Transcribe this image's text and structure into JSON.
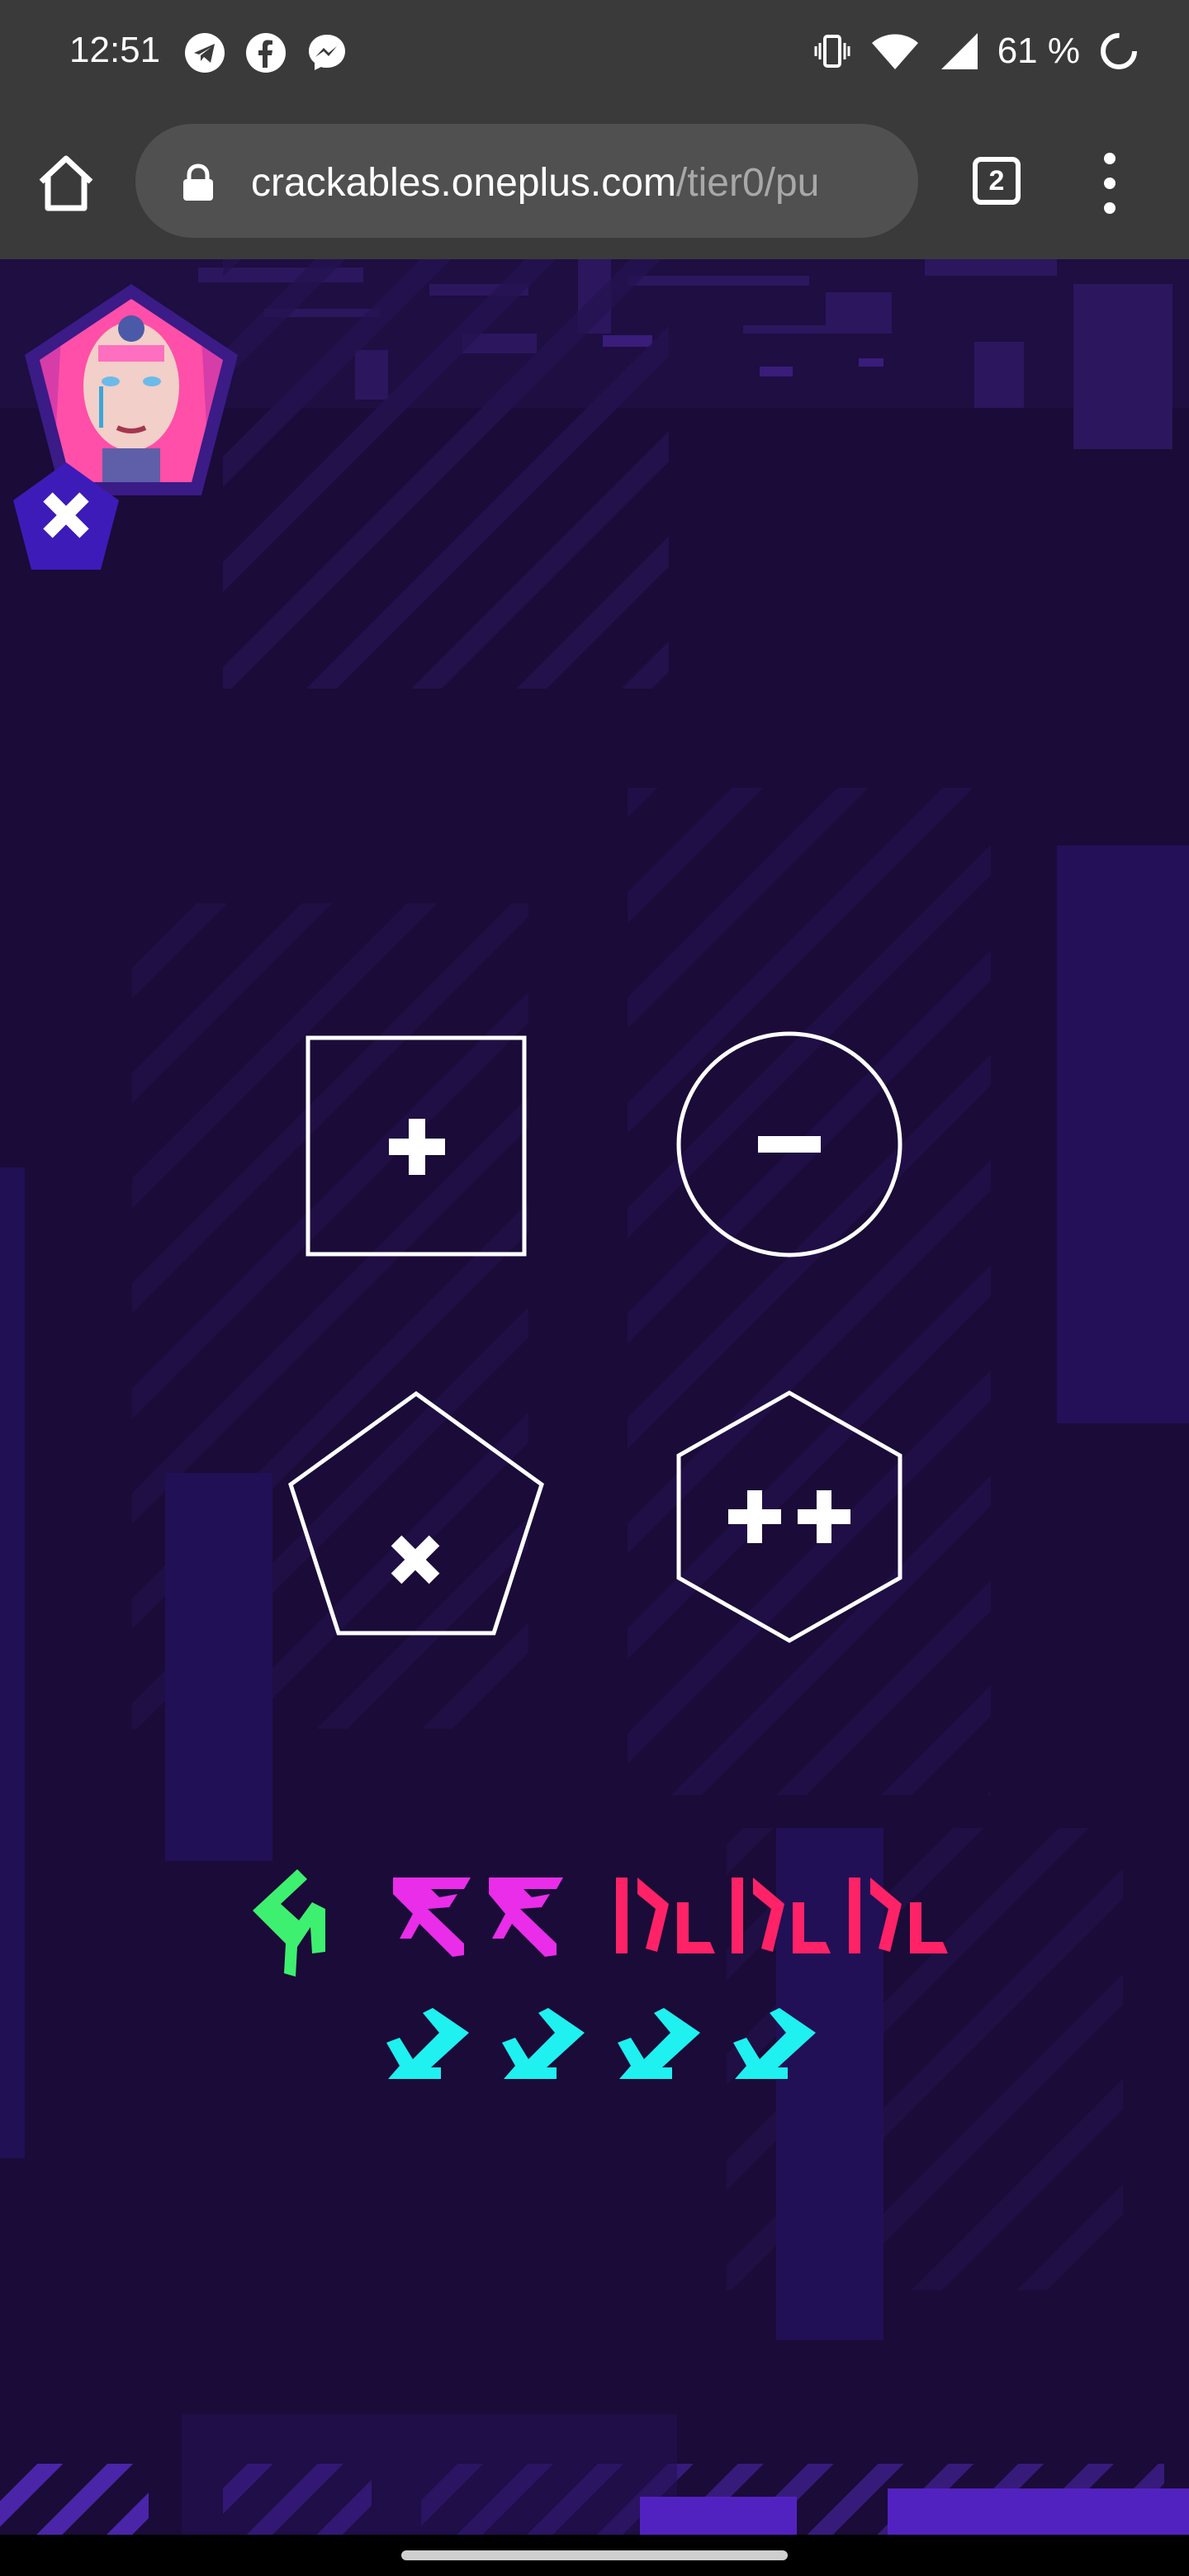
{
  "status_bar": {
    "time": "12:51",
    "battery_percent": "61 %",
    "left_icons": [
      "telegram-icon",
      "facebook-icon",
      "messenger-icon"
    ],
    "right_icons": [
      "vibrate-icon",
      "wifi-icon",
      "signal-icon",
      "battery-loading-icon"
    ]
  },
  "browser": {
    "url_domain": "crackables.oneplus.com",
    "url_path": "/tier0/pu",
    "tab_count": "2"
  },
  "game": {
    "buttons": [
      {
        "shape": "square",
        "symbol": "+"
      },
      {
        "shape": "circle",
        "symbol": "−"
      },
      {
        "shape": "pentagon",
        "symbol": "×"
      },
      {
        "shape": "hexagon",
        "symbol": "++"
      }
    ],
    "glyph_colors": {
      "green": "#3ef06f",
      "magenta": "#e92de8",
      "crimson": "#ff2266",
      "cyan": "#1ff0f0"
    },
    "glyph_row_1_counts": {
      "green": 1,
      "magenta": 2,
      "crimson": 3
    },
    "glyph_row_2_counts": {
      "cyan": 4
    }
  },
  "theme": {
    "background": "#1a0b38",
    "accent_purple": "#3a1c8c",
    "outline": "#ffffff"
  }
}
